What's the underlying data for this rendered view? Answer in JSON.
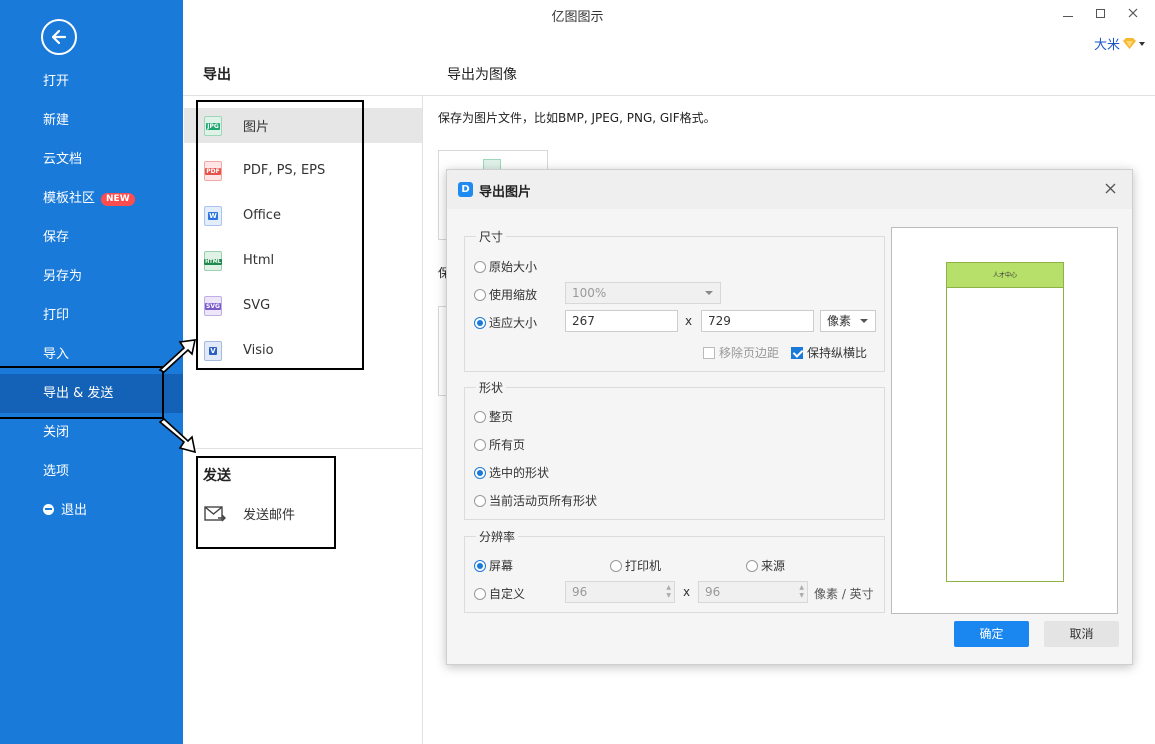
{
  "window": {
    "title": "亿图图示",
    "user_name": "大米"
  },
  "sidebar": {
    "items": [
      {
        "label": "打开"
      },
      {
        "label": "新建"
      },
      {
        "label": "云文档"
      },
      {
        "label": "模板社区",
        "badge": "NEW"
      },
      {
        "label": "保存"
      },
      {
        "label": "另存为"
      },
      {
        "label": "打印"
      },
      {
        "label": "导入"
      },
      {
        "label": "导出 & 发送",
        "active": true
      },
      {
        "label": "关闭"
      },
      {
        "label": "选项"
      },
      {
        "label": "退出"
      }
    ]
  },
  "export": {
    "title": "导出",
    "formats": [
      {
        "label": "图片",
        "icon_text": "JPG",
        "color": "#1ea56e"
      },
      {
        "label": "PDF, PS, EPS",
        "icon_text": "PDF",
        "color": "#e5534b"
      },
      {
        "label": "Office",
        "icon_text": "W",
        "color": "#2b73e0"
      },
      {
        "label": "Html",
        "icon_text": "HTML",
        "color": "#1e8a4c"
      },
      {
        "label": "SVG",
        "icon_text": "SVG",
        "color": "#7b5bc9"
      },
      {
        "label": "Visio",
        "icon_text": "V",
        "color": "#2b5fc0"
      }
    ]
  },
  "send": {
    "title": "发送",
    "email_label": "发送邮件"
  },
  "main": {
    "heading": "导出为图像",
    "description": "保存为图片文件，比如BMP, JPEG, PNG, GIF格式。",
    "partial_text": "保"
  },
  "dialog": {
    "title": "导出图片",
    "size": {
      "title": "尺寸",
      "original_label": "原始大小",
      "zoom_label": "使用缩放",
      "zoom_value": "100%",
      "fit_label": "适应大小",
      "width": "267",
      "height": "729",
      "x_sep": "x",
      "unit": "像素",
      "remove_margin_label": "移除页边距",
      "keep_ratio_label": "保持纵横比"
    },
    "shape": {
      "title": "形状",
      "options": [
        "整页",
        "所有页",
        "选中的形状",
        "当前活动页所有形状"
      ],
      "selected": 2
    },
    "resolution": {
      "title": "分辨率",
      "screen_label": "屏幕",
      "printer_label": "打印机",
      "source_label": "来源",
      "custom_label": "自定义",
      "dpi_x": "96",
      "dpi_y": "96",
      "x_sep": "x",
      "unit": "像素 / 英寸"
    },
    "preview_label": "人才中心",
    "ok_label": "确定",
    "cancel_label": "取消"
  }
}
